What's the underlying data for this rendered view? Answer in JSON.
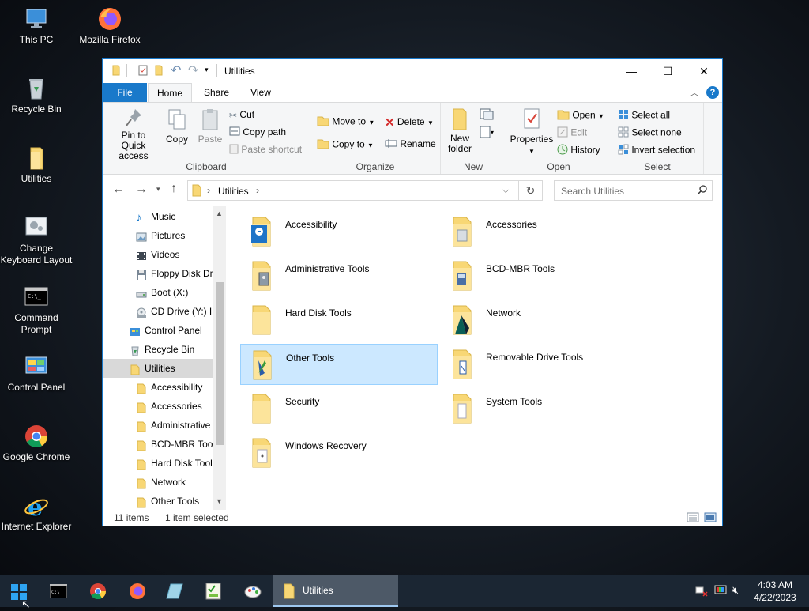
{
  "desktop": {
    "icons": [
      {
        "label": "This PC"
      },
      {
        "label": "Mozilla Firefox"
      },
      {
        "label": "Recycle Bin"
      },
      {
        "label": "Utilities"
      },
      {
        "label": "Change Keyboard Layout"
      },
      {
        "label": "Command Prompt"
      },
      {
        "label": "Control Panel"
      },
      {
        "label": "Google Chrome"
      },
      {
        "label": "Internet Explorer"
      }
    ]
  },
  "window": {
    "title": "Utilities",
    "controls": {
      "minimize": "—",
      "maximize": "☐",
      "close": "✕"
    },
    "tabs": [
      {
        "label": "File"
      },
      {
        "label": "Home"
      },
      {
        "label": "Share"
      },
      {
        "label": "View"
      }
    ],
    "ribbon": {
      "clipboard": {
        "label": "Clipboard",
        "pin": "Pin to Quick access",
        "copy": "Copy",
        "paste": "Paste",
        "cut": "Cut",
        "copy_path": "Copy path",
        "paste_shortcut": "Paste shortcut"
      },
      "organize": {
        "label": "Organize",
        "move_to": "Move to",
        "copy_to": "Copy to",
        "delete": "Delete",
        "rename": "Rename"
      },
      "new": {
        "label": "New",
        "new_folder": "New folder"
      },
      "open": {
        "label": "Open",
        "properties": "Properties",
        "open": "Open",
        "edit": "Edit",
        "history": "History"
      },
      "select": {
        "label": "Select",
        "select_all": "Select all",
        "select_none": "Select none",
        "invert": "Invert selection"
      }
    },
    "address": {
      "path": "Utilities",
      "search_placeholder": "Search Utilities"
    },
    "nav": {
      "items": [
        {
          "label": "Music"
        },
        {
          "label": "Pictures"
        },
        {
          "label": "Videos"
        },
        {
          "label": "Floppy Disk Dri"
        },
        {
          "label": "Boot (X:)"
        },
        {
          "label": "CD Drive (Y:) H"
        },
        {
          "label": "Control Panel"
        },
        {
          "label": "Recycle Bin"
        },
        {
          "label": "Utilities"
        },
        {
          "label": "Accessibility"
        },
        {
          "label": "Accessories"
        },
        {
          "label": "Administrative"
        },
        {
          "label": "BCD-MBR Tool"
        },
        {
          "label": "Hard Disk Tools"
        },
        {
          "label": "Network"
        },
        {
          "label": "Other Tools"
        }
      ]
    },
    "files": [
      {
        "name": "Accessibility"
      },
      {
        "name": "Accessories"
      },
      {
        "name": "Administrative Tools"
      },
      {
        "name": "BCD-MBR Tools"
      },
      {
        "name": "Hard Disk Tools"
      },
      {
        "name": "Network"
      },
      {
        "name": "Other Tools"
      },
      {
        "name": "Removable Drive Tools"
      },
      {
        "name": "Security"
      },
      {
        "name": "System Tools"
      },
      {
        "name": "Windows Recovery"
      }
    ],
    "status": {
      "count": "11 items",
      "selection": "1 item selected"
    }
  },
  "taskbar": {
    "active_label": "Utilities",
    "time": "4:03 AM",
    "date": "4/22/2023"
  },
  "colors": {
    "accent": "#1979ca",
    "selection": "#cce8ff",
    "folder": "#f8d775",
    "taskbar": "#1b2633"
  }
}
